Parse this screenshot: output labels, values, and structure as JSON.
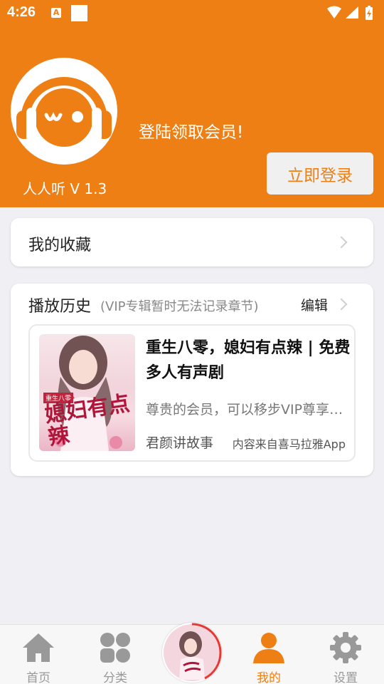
{
  "status_bar": {
    "time": "4:26",
    "notification_icon": "A"
  },
  "profile": {
    "app_version": "人人听 V 1.3",
    "login_prompt": "登陆领取会员!",
    "login_button": "立即登录"
  },
  "favorites": {
    "label": "我的收藏"
  },
  "history": {
    "title": "播放历史",
    "note": "(VIP专辑暂时无法记录章节)",
    "edit": "编辑",
    "items": [
      {
        "title": "重生八零，媳妇有点辣 | 免费多人有声剧",
        "description": "尊贵的会员，可以移步VIP尊享专区收听哦",
        "author": "君颜讲故事",
        "source": "内容来自喜马拉雅App",
        "cover_text": "媳妇有点辣",
        "cover_badge": "重生八零"
      }
    ]
  },
  "tab_bar": {
    "tabs": [
      {
        "label": "首页",
        "icon": "home-icon"
      },
      {
        "label": "分类",
        "icon": "grid-icon"
      },
      {
        "label": "我的",
        "icon": "user-icon",
        "active": true
      },
      {
        "label": "设置",
        "icon": "gear-icon"
      }
    ]
  },
  "colors": {
    "brand": "#ee7f14",
    "background": "#efeff4",
    "inactive": "#999999"
  }
}
